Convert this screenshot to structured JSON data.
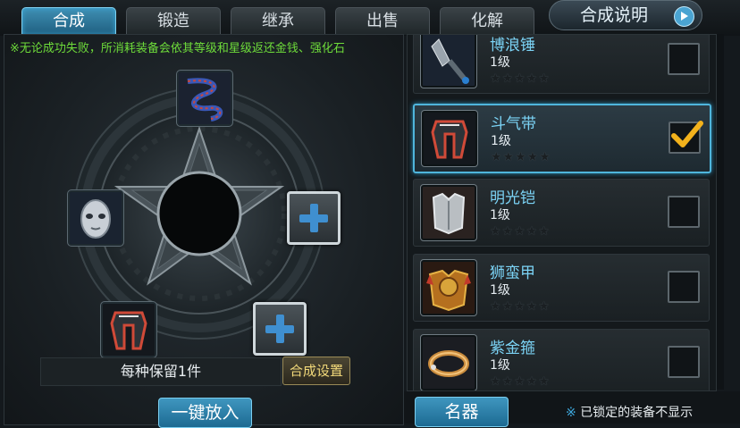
{
  "tabs": [
    {
      "label": "合成",
      "active": true
    },
    {
      "label": "锻造",
      "active": false
    },
    {
      "label": "继承",
      "active": false
    },
    {
      "label": "出售",
      "active": false
    },
    {
      "label": "化解",
      "active": false
    }
  ],
  "help_button": {
    "label": "合成说明"
  },
  "notice": "※无论成功失败，所消耗装备会依其等级和星级返还金钱、强化石",
  "slots": [
    {
      "item": "rope-chain-icon"
    },
    {
      "item": "silver-mask-icon"
    },
    {
      "item": "add"
    },
    {
      "item": "helmet-icon"
    },
    {
      "item": "add"
    }
  ],
  "keep_box": "每种保留1件",
  "synth_settings_button": "合成设置",
  "one_key_button": "一键放入",
  "items": [
    {
      "name": "博浪锤",
      "level": "1级",
      "stars": "★★★★★",
      "checked": false,
      "icon": "mace-icon"
    },
    {
      "name": "斗气带",
      "level": "1级",
      "stars": "★★★★★",
      "checked": true,
      "icon": "helmet-icon"
    },
    {
      "name": "明光铠",
      "level": "1级",
      "stars": "★★★★★",
      "checked": false,
      "icon": "breastplate-icon"
    },
    {
      "name": "狮蛮甲",
      "level": "1级",
      "stars": "★★★★★",
      "checked": false,
      "icon": "lion-armor-icon"
    },
    {
      "name": "紫金箍",
      "level": "1级",
      "stars": "★★★★★",
      "checked": false,
      "icon": "ring-icon"
    }
  ],
  "famous_button": "名器",
  "locked_note": {
    "mark": "※",
    "text": "已锁定的装备不显示"
  },
  "colors": {
    "accent": "#3f96bf",
    "notice": "#6edc3a",
    "item_name": "#7bd3f5",
    "settings": "#f2d97a"
  }
}
